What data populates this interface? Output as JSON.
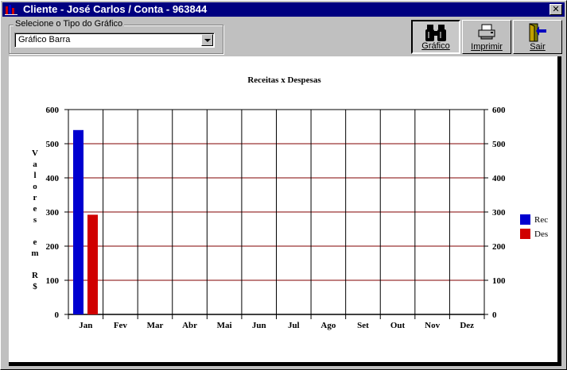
{
  "window": {
    "title": "Cliente - José Carlos / Conta - 963844",
    "close_label": "✕"
  },
  "chart_type_selector": {
    "group_label": "Selecione o Tipo do Gráfico",
    "selected": "Gráfico Barra"
  },
  "toolbar": {
    "grafico_label": "Gráfico",
    "imprimir_label": "Imprimir",
    "sair_label": "Sair"
  },
  "colors": {
    "rec": "#0000d0",
    "des": "#d00000",
    "grid": "#800000",
    "title_bar": "#000080"
  },
  "chart_data": {
    "type": "bar",
    "title": "Receitas x Despesas",
    "ylabel_chars": [
      "V",
      "a",
      "l",
      "o",
      "r",
      "e",
      "s",
      "",
      "e",
      "m",
      "",
      "R",
      "$"
    ],
    "categories": [
      "Jan",
      "Fev",
      "Mar",
      "Abr",
      "Mai",
      "Jun",
      "Jul",
      "Ago",
      "Set",
      "Out",
      "Nov",
      "Dez"
    ],
    "series": [
      {
        "name": "Rec",
        "values": [
          540,
          0,
          0,
          0,
          0,
          0,
          0,
          0,
          0,
          0,
          0,
          0
        ]
      },
      {
        "name": "Des",
        "values": [
          292,
          0,
          0,
          0,
          0,
          0,
          0,
          0,
          0,
          0,
          0,
          0
        ]
      }
    ],
    "ylim": [
      0,
      600
    ],
    "yticks": [
      0,
      100,
      200,
      300,
      400,
      500,
      600
    ],
    "grid": true,
    "legend_position": "right",
    "secondary_axis": true
  }
}
